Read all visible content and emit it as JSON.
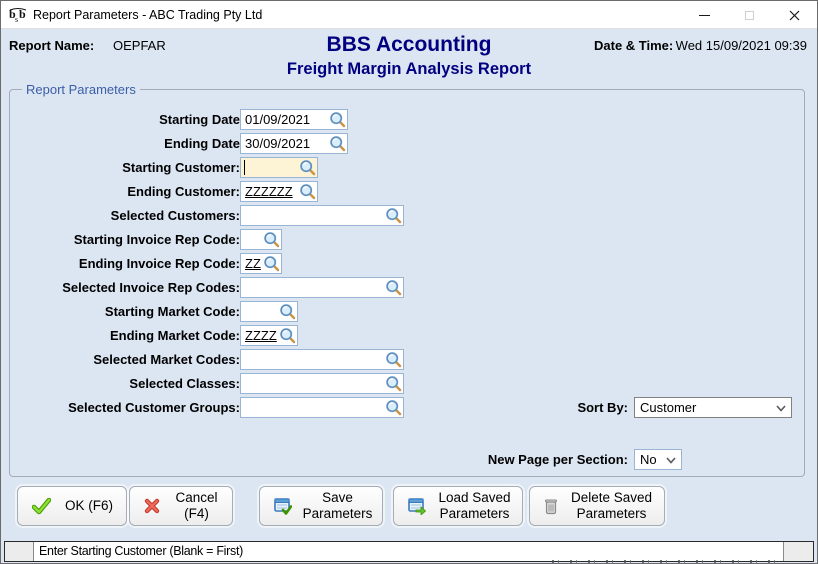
{
  "window": {
    "title": "Report Parameters - ABC Trading Pty Ltd"
  },
  "header": {
    "report_name_label": "Report Name:",
    "report_name_value": "OEPFAR",
    "app_title": "BBS Accounting",
    "report_title": "Freight Margin Analysis Report",
    "datetime_label": "Date & Time:",
    "datetime_value": "Wed 15/09/2021 09:39"
  },
  "parameters": {
    "group_label": "Report Parameters",
    "fields": [
      {
        "label": "Starting Date",
        "value": "01/09/2021"
      },
      {
        "label": "Ending Date",
        "value": "30/09/2021"
      },
      {
        "label": "Starting Customer:",
        "value": ""
      },
      {
        "label": "Ending Customer:",
        "value": "ZZZZZZ"
      },
      {
        "label": "Selected Customers:",
        "value": ""
      },
      {
        "label": "Starting Invoice Rep Code:",
        "value": ""
      },
      {
        "label": "Ending Invoice Rep Code:",
        "value": "ZZ"
      },
      {
        "label": "Selected Invoice Rep Codes:",
        "value": ""
      },
      {
        "label": "Starting Market Code:",
        "value": ""
      },
      {
        "label": "Ending Market Code:",
        "value": "ZZZZ"
      },
      {
        "label": "Selected Market Codes:",
        "value": ""
      },
      {
        "label": "Selected Classes:",
        "value": ""
      },
      {
        "label": "Selected Customer Groups:",
        "value": ""
      }
    ],
    "sort_by": {
      "label": "Sort By:",
      "value": "Customer"
    },
    "new_page": {
      "label": "New Page per Section:",
      "value": "No"
    }
  },
  "buttons": {
    "ok": "OK (F6)",
    "cancel": "Cancel (F4)",
    "save": "Save Parameters",
    "load": "Load Saved Parameters",
    "delete": "Delete Saved Parameters"
  },
  "status_bar": {
    "message": "Enter Starting Customer (Blank = First)"
  },
  "icons": {
    "app": "bsb-logo",
    "lookup": "magnifier",
    "ok": "green-check",
    "cancel": "red-cross",
    "save": "grid-with-green-check",
    "load": "grid-with-green-arrow",
    "delete": "trash-can",
    "dropdowns": "chevron-down"
  },
  "colors": {
    "window_bg": "#dce6f2",
    "accent_navy": "#010080",
    "group_label_blue": "#3c5ea8",
    "field_border": "#9ab5d4",
    "focused_field_bg": "#fdf4d6"
  }
}
